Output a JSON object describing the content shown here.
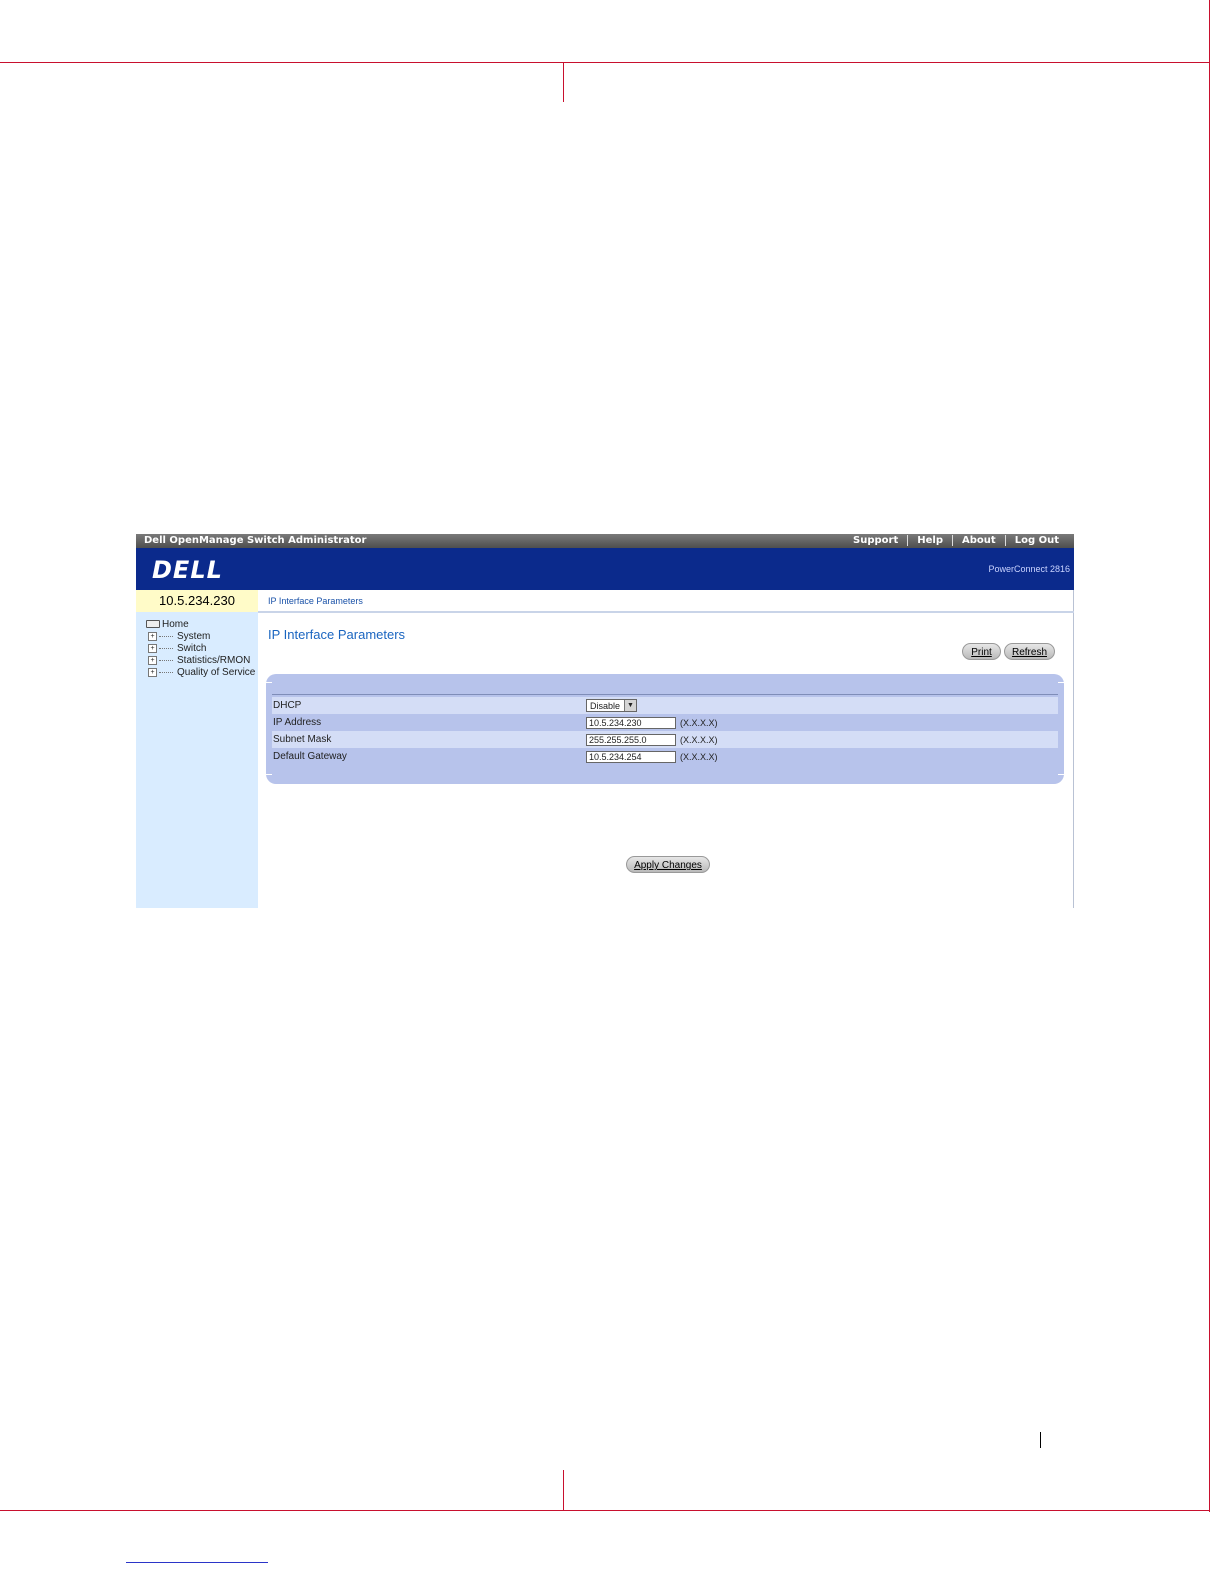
{
  "app": {
    "title": "Dell OpenManage Switch Administrator",
    "top_links": [
      "Support",
      "Help",
      "About",
      "Log Out"
    ],
    "logo": "DELL",
    "model": "PowerConnect 2816"
  },
  "sidebar": {
    "device_ip": "10.5.234.230",
    "tree": {
      "root": "Home",
      "items": [
        "System",
        "Switch",
        "Statistics/RMON",
        "Quality of Service"
      ]
    }
  },
  "main": {
    "breadcrumb": "IP Interface Parameters",
    "title": "IP Interface Parameters",
    "print_label": "Print",
    "refresh_label": "Refresh",
    "apply_label": "Apply Changes",
    "fields": {
      "dhcp": {
        "label": "DHCP",
        "value": "Disable"
      },
      "ip_address": {
        "label": "IP Address",
        "value": "10.5.234.230",
        "hint": "(X.X.X.X)"
      },
      "subnet_mask": {
        "label": "Subnet Mask",
        "value": "255.255.255.0",
        "hint": "(X.X.X.X)"
      },
      "default_gateway": {
        "label": "Default Gateway",
        "value": "10.5.234.254",
        "hint": "(X.X.X.X)"
      }
    }
  }
}
